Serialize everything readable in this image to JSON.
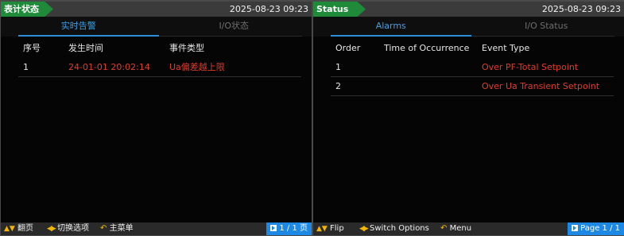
{
  "panels": [
    {
      "lang": "zh",
      "status_label": "表计状态",
      "datetime": "2025-08-23 09:23",
      "tabs": [
        "实时告警",
        "I/O状态"
      ],
      "columns": [
        "序号",
        "发生时间",
        "事件类型"
      ],
      "rows": [
        {
          "order": "1",
          "time": "24-01-01 20:02:14",
          "event": "Ua偏差越上限"
        }
      ],
      "bottom": {
        "flip": "翻页",
        "switch": "切换选项",
        "menu": "主菜单",
        "page": "1 / 1 页"
      }
    },
    {
      "lang": "en",
      "status_label": "Status",
      "datetime": "2025-08-23 09:23",
      "tabs": [
        "Alarms",
        "I/O Status"
      ],
      "columns": [
        "Order",
        "Time of Occurrence",
        "Event Type"
      ],
      "rows": [
        {
          "order": "1",
          "time": "",
          "event": "Over PF-Total Setpoint"
        },
        {
          "order": "2",
          "time": "",
          "event": "Over Ua Transient Setpoint"
        }
      ],
      "bottom": {
        "flip": "Flip",
        "switch": "Switch Options",
        "menu": "Menu",
        "page": "Page 1 / 1"
      }
    }
  ],
  "colors": {
    "status_green": "#1f8a3a",
    "tab_active": "#3aa0e6",
    "alarm_red": "#e23b2a",
    "page_blue": "#1e88e5",
    "key_yellow": "#f2b705"
  },
  "icons": {
    "flip": "up-down-arrows-icon",
    "switch": "left-right-arrows-icon",
    "menu": "return-icon",
    "page": "page-icon"
  }
}
